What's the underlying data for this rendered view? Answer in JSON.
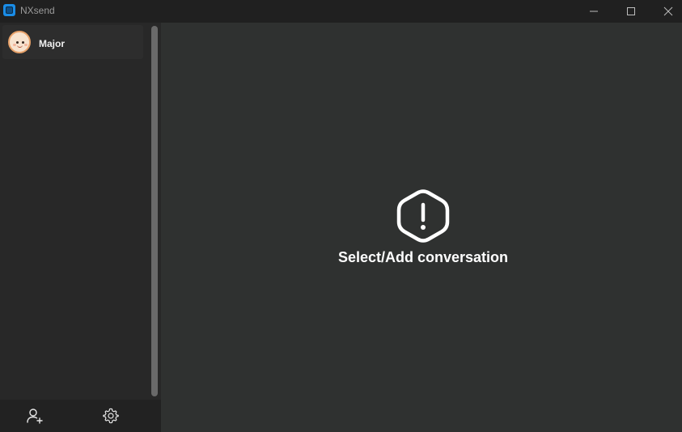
{
  "window": {
    "title": "NXsend",
    "app_icon": "nxsend-app-icon",
    "controls": {
      "minimize_icon": "minimize-icon",
      "maximize_icon": "maximize-icon",
      "close_icon": "close-icon"
    }
  },
  "sidebar": {
    "contacts": [
      {
        "name": "Major",
        "avatar": "baby-face-avatar"
      }
    ],
    "footer": {
      "add_contact_icon": "add-user-icon",
      "settings_icon": "gear-icon"
    }
  },
  "main": {
    "empty_state": {
      "icon": "warning-hexagon-icon",
      "message": "Select/Add conversation"
    }
  },
  "colors": {
    "titlebar_bg": "#202020",
    "sidebar_bg": "#282828",
    "main_bg": "#2f3130",
    "accent": "#1a8ce6",
    "text": "#ffffff"
  }
}
